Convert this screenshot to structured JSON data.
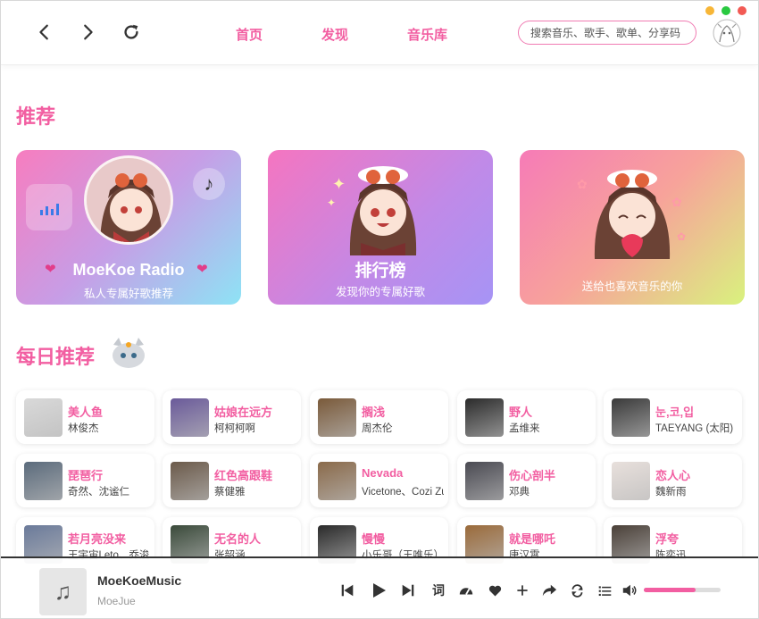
{
  "header": {
    "nav": [
      "首页",
      "发现",
      "音乐库"
    ],
    "search_placeholder": "搜索音乐、歌手、歌单、分享码"
  },
  "colors": {
    "accent": "#f25ea1",
    "traffic": [
      "#f7b637",
      "#29c940",
      "#f25a54"
    ]
  },
  "recommend": {
    "title": "推荐",
    "cards": [
      {
        "title": "MoeKoe Radio",
        "subtitle": "私人专属好歌推荐"
      },
      {
        "title": "排行榜",
        "subtitle": "发现你的专属好歌"
      },
      {
        "title": "",
        "subtitle": "送给也喜欢音乐的你"
      }
    ]
  },
  "daily": {
    "title": "每日推荐",
    "songs": [
      {
        "name": "美人鱼",
        "artist": "林俊杰",
        "color": "#d9d9d9"
      },
      {
        "name": "姑娘在远方",
        "artist": "柯柯柯啊",
        "color": "#6a5a9a"
      },
      {
        "name": "搁浅",
        "artist": "周杰伦",
        "color": "#7a5a3a"
      },
      {
        "name": "野人",
        "artist": "孟维来",
        "color": "#2b2b2b"
      },
      {
        "name": "눈,코,입",
        "artist": "TAEYANG (太阳)",
        "color": "#3a3a3a"
      },
      {
        "name": "琵琶行",
        "artist": "奇然、沈谧仁",
        "color": "#5b6b7c"
      },
      {
        "name": "红色高跟鞋",
        "artist": "蔡健雅",
        "color": "#6b5a4a"
      },
      {
        "name": "Nevada",
        "artist": "Vicetone、Cozi Zuehlsdorff",
        "color": "#8a6a4a"
      },
      {
        "name": "伤心剖半",
        "artist": "邓典",
        "color": "#4a4a52"
      },
      {
        "name": "恋人心",
        "artist": "魏新雨",
        "color": "#e8e0dc"
      },
      {
        "name": "若月亮没来",
        "artist": "王宇宙Leto、乔浚丞",
        "color": "#6a7a9a"
      },
      {
        "name": "无名的人",
        "artist": "张韶涵",
        "color": "#3a4a3a"
      },
      {
        "name": "慢慢",
        "artist": "小乐哥（王唯乐）",
        "color": "#2a2a2a"
      },
      {
        "name": "就是哪吒",
        "artist": "唐汉霄",
        "color": "#9a6a3a"
      },
      {
        "name": "浮夸",
        "artist": "陈奕迅",
        "color": "#4a4038"
      }
    ]
  },
  "player": {
    "title": "MoeKoeMusic",
    "artist": "MoeJue",
    "lyrics_label": "词",
    "volume": 0.67
  }
}
